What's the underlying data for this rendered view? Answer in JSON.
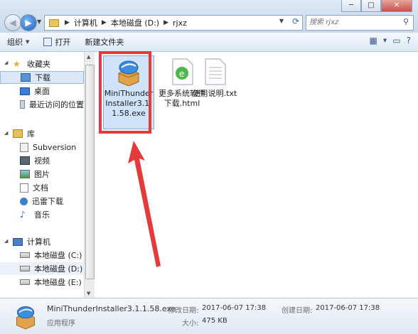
{
  "window_controls": {
    "minimize": "─",
    "maximize": "□",
    "close": "✕"
  },
  "address": {
    "crumbs": [
      "计算机",
      "本地磁盘 (D:)",
      "rjxz"
    ]
  },
  "search": {
    "placeholder": "搜索 rjxz"
  },
  "toolbar": {
    "organize": "组织",
    "open": "打开",
    "new_folder": "新建文件夹"
  },
  "sidebar": {
    "favorites": "收藏夹",
    "downloads": "下载",
    "desktop": "桌面",
    "recent": "最近访问的位置",
    "libraries": "库",
    "subversion": "Subversion",
    "videos": "视频",
    "pictures": "图片",
    "documents": "文档",
    "thunder": "迅雷下载",
    "music": "音乐",
    "computer": "计算机",
    "drive_c": "本地磁盘 (C:)",
    "drive_d": "本地磁盘 (D:)",
    "drive_e": "本地磁盘 (E:)"
  },
  "files": [
    {
      "name": "MiniThunderInstaller3.1.1.58.exe"
    },
    {
      "name": "更多系统软件下载.html"
    },
    {
      "name": "使用说明.txt"
    }
  ],
  "details": {
    "filename": "MiniThunderInstaller3.1.1.58.exe",
    "type": "应用程序",
    "modified_label": "修改日期:",
    "modified": "2017-06-07 17:38",
    "size_label": "大小:",
    "size": "475 KB",
    "created_label": "创建日期:",
    "created": "2017-06-07 17:38"
  },
  "colors": {
    "annotation": "#e53a3a",
    "selection": "#cfe3fa"
  }
}
